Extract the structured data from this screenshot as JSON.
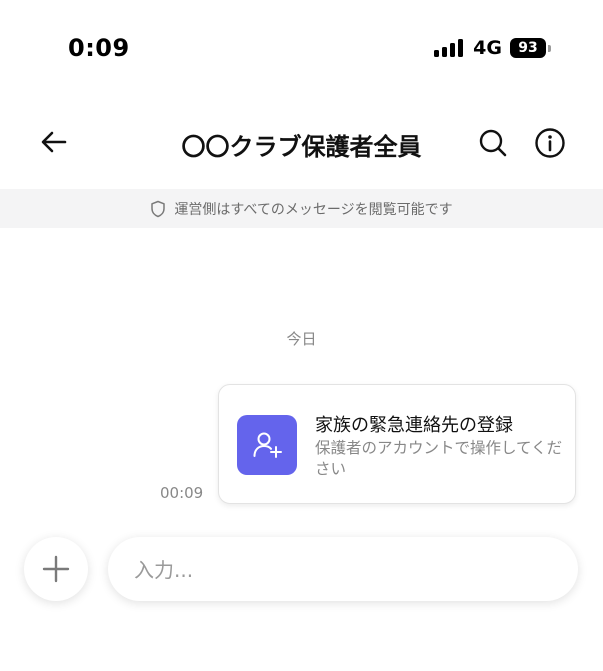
{
  "status_bar": {
    "time": "0:09",
    "network": "4G",
    "battery": "93"
  },
  "header": {
    "title": "〇〇クラブ保護者全員",
    "back_icon": "arrow-left-icon",
    "search_icon": "search-icon",
    "info_icon": "info-icon"
  },
  "notice": {
    "icon": "shield-icon",
    "text": "運営側はすべてのメッセージを閲覧可能です"
  },
  "chat": {
    "date_label": "今日",
    "messages": [
      {
        "time": "00:09",
        "card_title": "家族の緊急連絡先の登録",
        "card_subtitle": "保護者のアカウントで操作してください",
        "card_icon": "user-plus-icon"
      }
    ]
  },
  "composer": {
    "add_icon": "plus-icon",
    "placeholder": "入力...",
    "value": ""
  },
  "colors": {
    "accent": "#6464ec",
    "banner_bg": "#f4f4f5",
    "muted_text": "#888888"
  }
}
